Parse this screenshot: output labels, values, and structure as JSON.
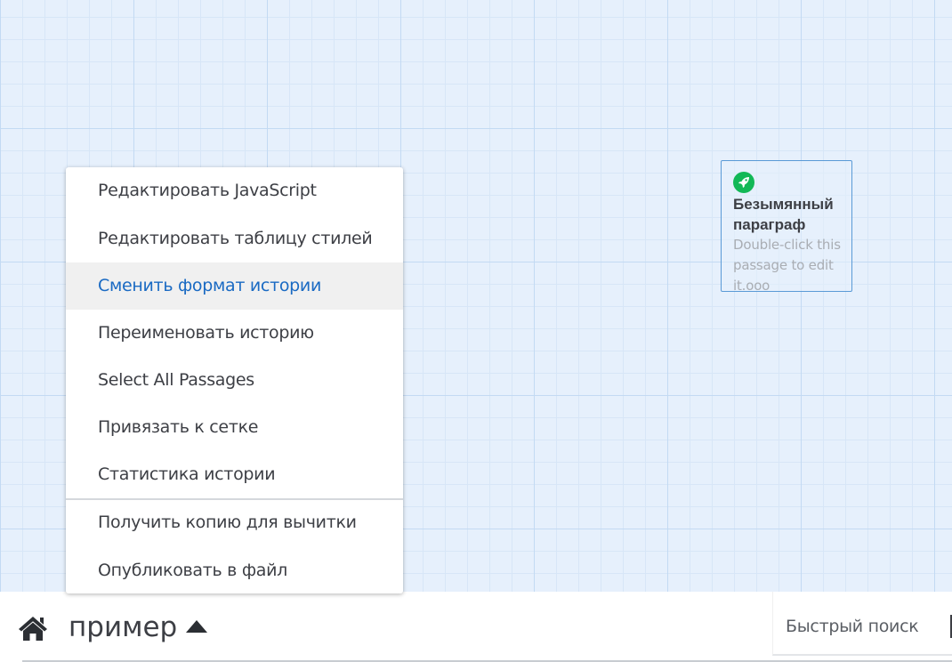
{
  "passage": {
    "title": "Безымянный параграф",
    "excerpt": "Double-click this passage to edit it.ооо",
    "start_icon": "rocket-icon"
  },
  "menu": {
    "items": [
      {
        "label": "Редактировать JavaScript"
      },
      {
        "label": "Редактировать таблицу стилей"
      },
      {
        "label": "Сменить формат истории"
      },
      {
        "label": "Переименовать историю"
      },
      {
        "label": "Select All Passages"
      },
      {
        "label": "Привязать к сетке"
      },
      {
        "label": "Статистика истории"
      },
      {
        "label": "Получить копию для вычитки"
      },
      {
        "label": "Опубликовать в файл"
      }
    ],
    "highlight_color": "#1a6ac3"
  },
  "toolbar": {
    "home_icon": "home-icon",
    "story_title": "пример",
    "caret_icon": "caret-up-icon",
    "search_placeholder": "Быстрый поиск"
  },
  "colors": {
    "canvas": "#e6f0fc",
    "start_passage_badge": "#12b856"
  }
}
